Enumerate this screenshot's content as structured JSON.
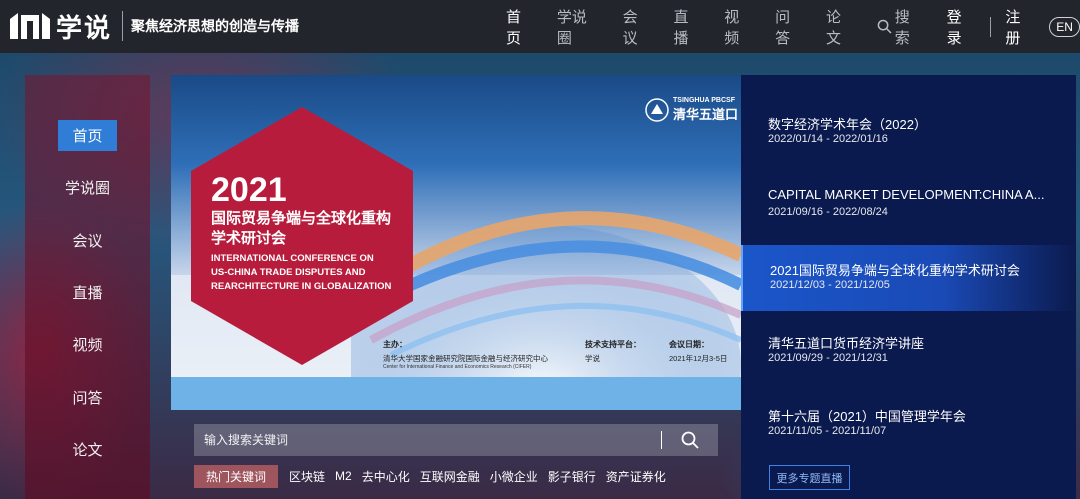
{
  "header": {
    "logo_text": "学说",
    "slogan": "聚焦经济思想的创造与传播",
    "nav": [
      {
        "label": "首页",
        "active": true
      },
      {
        "label": "学说圈",
        "active": false
      },
      {
        "label": "会议",
        "active": false
      },
      {
        "label": "直播",
        "active": false
      },
      {
        "label": "视频",
        "active": false
      },
      {
        "label": "问答",
        "active": false
      },
      {
        "label": "论文",
        "active": false
      }
    ],
    "search_label": "搜索",
    "login": "登录",
    "register": "注册",
    "lang": "EN"
  },
  "sidebar": {
    "items": [
      {
        "label": "首页",
        "active": true
      },
      {
        "label": "学说圈",
        "active": false
      },
      {
        "label": "会议",
        "active": false
      },
      {
        "label": "直播",
        "active": false
      },
      {
        "label": "视频",
        "active": false
      },
      {
        "label": "问答",
        "active": false
      },
      {
        "label": "论文",
        "active": false
      }
    ]
  },
  "banner": {
    "year": "2021",
    "title_cn_1": "国际贸易争端与全球化重构",
    "title_cn_2": "学术研讨会",
    "title_en_1": "INTERNATIONAL CONFERENCE ON",
    "title_en_2": "US-CHINA TRADE DISPUTES AND",
    "title_en_3": "REARCHITECTURE IN GLOBALIZATION",
    "org_en": "TSINGHUA PBCSF",
    "org_cn": "清华五道口",
    "host_label": "主办：",
    "host_value": "清华大学国家金融研究院国际金融与经济研究中心",
    "host_sub": "Center for International Finance and Economics Research (CIFER)",
    "tech_label": "技术支持平台：",
    "tech_value": "学说",
    "date_label": "会议日期：",
    "date_value": "2021年12月3-5日"
  },
  "search": {
    "placeholder": "输入搜索关键词",
    "hot_label": "热门关键词",
    "hot_words": [
      "区块链",
      "M2",
      "去中心化",
      "互联网金融",
      "小微企业",
      "影子银行",
      "资产证券化"
    ]
  },
  "events": [
    {
      "title": "数字经济学术年会（2022）",
      "date": "2022/01/14 - 2022/01/16",
      "active": false
    },
    {
      "title": "CAPITAL MARKET DEVELOPMENT:CHINA A...",
      "date": "2021/09/16 - 2022/08/24",
      "active": false
    },
    {
      "title": "2021国际贸易争端与全球化重构学术研讨会",
      "date": "2021/12/03 - 2021/12/05",
      "active": true
    },
    {
      "title": "清华五道口货币经济学讲座",
      "date": "2021/09/29 - 2021/12/31",
      "active": false
    },
    {
      "title": "第十六届（2021）中国管理学年会",
      "date": "2021/11/05 - 2021/11/07",
      "active": false
    }
  ],
  "more_button": "更多专题直播",
  "colors": {
    "accent_blue": "#2f7dd6",
    "hexagon_red": "#b81c3c",
    "list_bg": "#0b1a4e"
  }
}
